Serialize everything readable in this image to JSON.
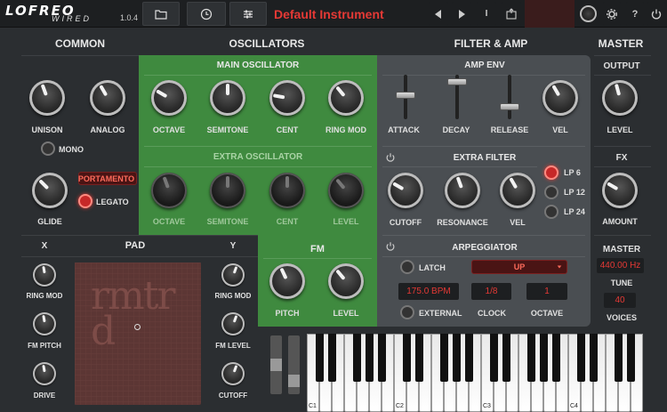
{
  "app": {
    "logo": "LOFREO",
    "logo_sub": "WIRED",
    "version": "1.0.4",
    "preset_name": "Default Instrument"
  },
  "toolbar": {
    "icons": [
      "folder-icon",
      "clock-icon",
      "sliders-icon",
      "prev-icon",
      "next-icon",
      "info-icon",
      "export-icon",
      "knob-icon",
      "gear-icon",
      "help-icon"
    ],
    "info_label": "I",
    "help_label": "?"
  },
  "sections": {
    "common": "COMMON",
    "oscillators": "OSCILLATORS",
    "filter_amp": "FILTER & AMP",
    "master": "MASTER"
  },
  "common": {
    "knobs": [
      {
        "label": "UNISON"
      },
      {
        "label": "ANALOG"
      },
      {
        "label": "GLIDE"
      }
    ],
    "mono_label": "MONO",
    "portamento": "PORTAMENTO",
    "legato_label": "LEGATO"
  },
  "main_osc": {
    "title": "MAIN OSCILLATOR",
    "knobs": [
      "OCTAVE",
      "SEMITONE",
      "CENT",
      "RING MOD"
    ]
  },
  "extra_osc": {
    "title": "EXTRA OSCILLATOR",
    "knobs": [
      "OCTAVE",
      "SEMITONE",
      "CENT",
      "LEVEL"
    ]
  },
  "fm": {
    "title": "FM",
    "knobs": [
      "PITCH",
      "LEVEL"
    ]
  },
  "amp_env": {
    "title": "AMP ENV",
    "faders": [
      "ATTACK",
      "DECAY",
      "RELEASE"
    ],
    "fader_levels": [
      0.55,
      0.9,
      0.25
    ],
    "vel_label": "VEL"
  },
  "extra_filter": {
    "title": "EXTRA FILTER",
    "knobs": [
      "CUTOFF",
      "RESONANCE",
      "VEL"
    ],
    "modes": [
      "LP 6",
      "LP 12",
      "LP 24"
    ],
    "selected_mode": "LP 6"
  },
  "arp": {
    "title": "ARPEGGIATOR",
    "latch_label": "LATCH",
    "direction": "UP",
    "bpm": "175.0 BPM",
    "clock": "1/8",
    "octave_value": "1",
    "external_label": "EXTERNAL",
    "clock_label": "CLOCK",
    "octave_label": "OCTAVE"
  },
  "master": {
    "output": "OUTPUT",
    "level": "LEVEL",
    "fx": "FX",
    "amount": "AMOUNT",
    "master_title": "MASTER",
    "tune_value": "440.00 Hz",
    "tune_label": "TUNE",
    "voices_value": "40",
    "voices_label": "VOICES"
  },
  "pad": {
    "title": "PAD",
    "x_label": "X",
    "y_label": "Y",
    "left_knobs": [
      "RING MOD",
      "FM PITCH",
      "DRIVE"
    ],
    "right_knobs": [
      "RING MOD",
      "FM LEVEL",
      "CUTOFF"
    ],
    "watermark": "rmtrd"
  },
  "keyboard": {
    "labels": [
      "C1",
      "C2",
      "C3",
      "C4"
    ]
  },
  "colors": {
    "accent": "#e53935",
    "green_panel": "#3f8a3f",
    "grey_panel": "#4a4e52",
    "background": "#2b2e31"
  }
}
